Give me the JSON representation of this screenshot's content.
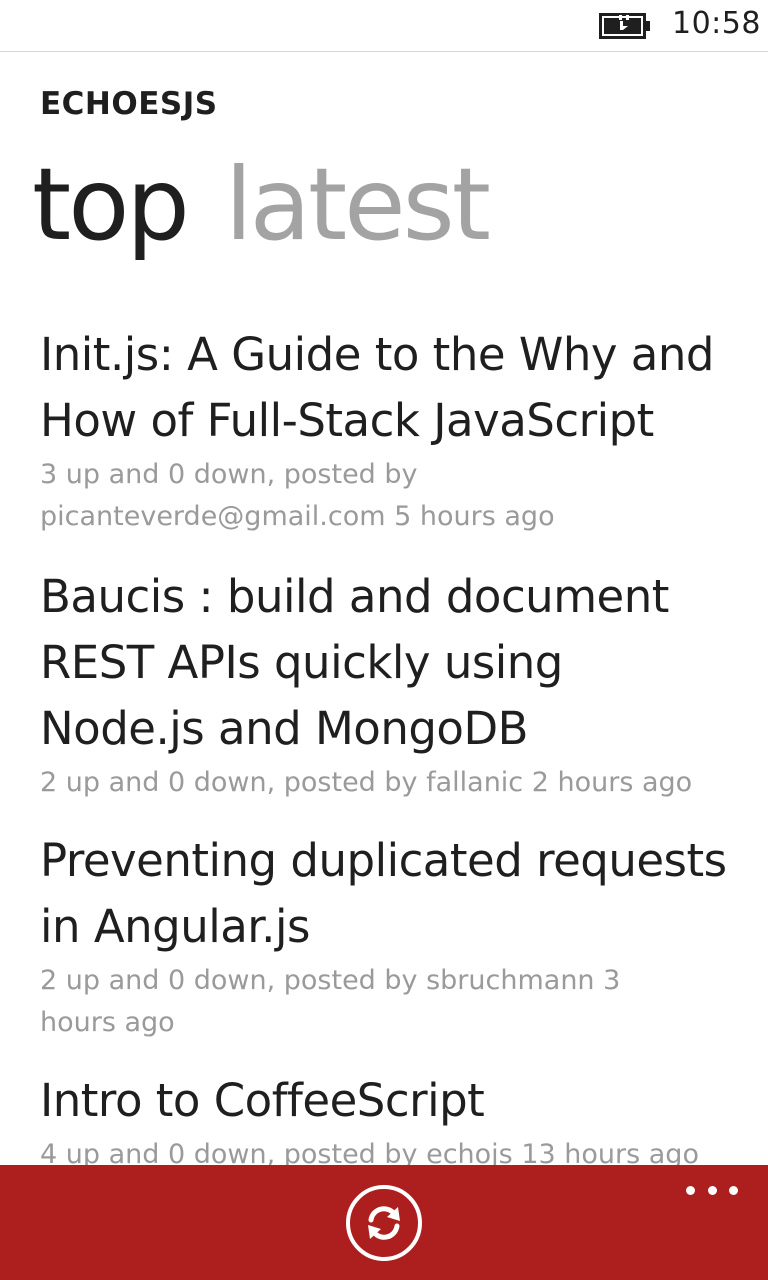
{
  "status_bar": {
    "battery_icon": "battery-charging-icon",
    "time": "10:58"
  },
  "header": {
    "app_title": "ECHOESJS",
    "tabs": [
      {
        "label": "top",
        "active": true
      },
      {
        "label": "latest",
        "active": false
      }
    ]
  },
  "articles": [
    {
      "title_lines": [
        "Init.js: A Guide to the Why and",
        "How of Full-Stack JavaScript"
      ],
      "meta_lines": [
        "3 up and 0 down, posted by",
        "picanteverde@gmail.com 5 hours ago"
      ]
    },
    {
      "title_lines": [
        "Baucis : build and document",
        "REST APIs quickly using",
        "Node.js and MongoDB"
      ],
      "meta_lines": [
        "2 up and 0 down, posted by fallanic 2 hours ago"
      ]
    },
    {
      "title_lines": [
        "Preventing duplicated requests",
        "in Angular.js"
      ],
      "meta_lines": [
        "2 up and 0 down, posted by sbruchmann 3",
        "hours ago"
      ]
    },
    {
      "title_lines": [
        "Intro to CoffeeScript"
      ],
      "meta_lines": [
        "4 up and 0 down, posted by echojs 13 hours ago"
      ]
    }
  ],
  "app_bar": {
    "refresh_icon": "refresh-icon",
    "more_icon": "more-dots-icon",
    "background_color": "#ad1e1e"
  }
}
